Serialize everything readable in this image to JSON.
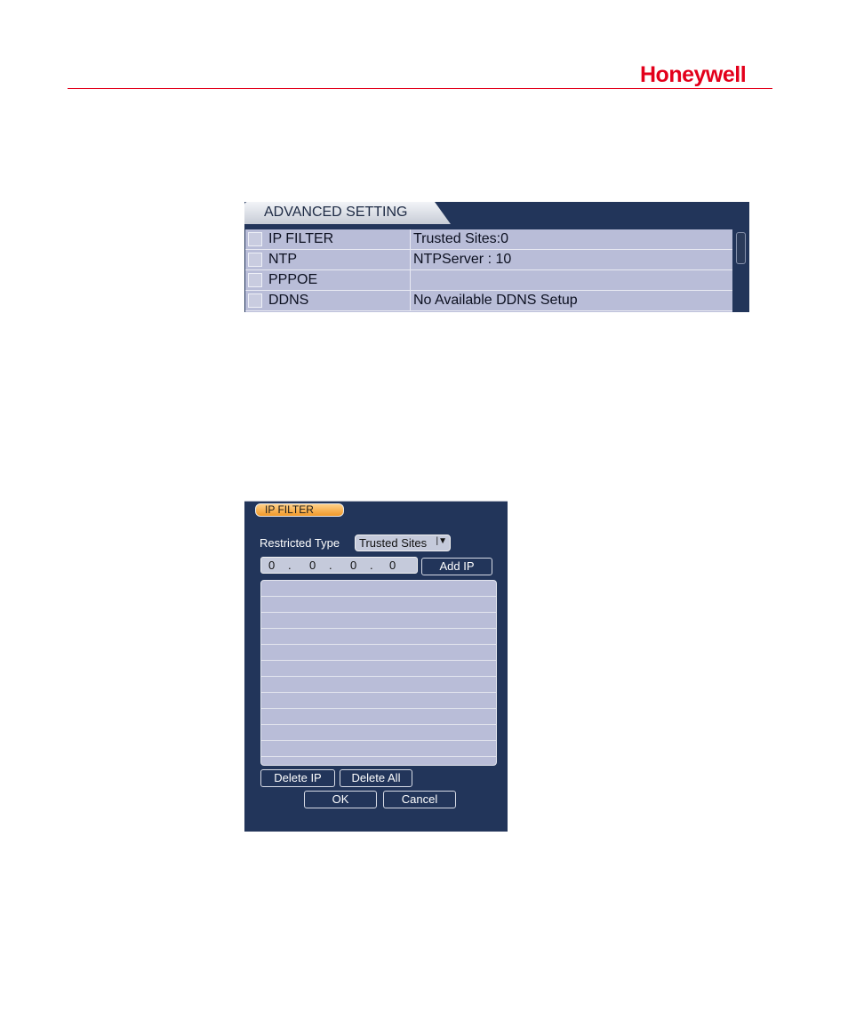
{
  "header": {
    "brand": "Honeywell"
  },
  "advanced_setting": {
    "title": "ADVANCED SETTING",
    "rows": [
      {
        "name": "IP FILTER",
        "value": "Trusted Sites:0"
      },
      {
        "name": "NTP",
        "value": "NTPServer : 10"
      },
      {
        "name": "PPPOE",
        "value": ""
      },
      {
        "name": "DDNS",
        "value": "No Available DDNS Setup"
      }
    ]
  },
  "ip_filter": {
    "title": "IP FILTER",
    "restricted_type_label": "Restricted Type",
    "restricted_type_value": "Trusted Sites",
    "ip_octets": [
      "0",
      "0",
      "0",
      "0"
    ],
    "add_ip": "Add IP",
    "delete_ip": "Delete IP",
    "delete_all": "Delete All",
    "ok": "OK",
    "cancel": "Cancel"
  },
  "colors": {
    "brand_red": "#e3001b",
    "panel_navy": "#22355a",
    "list_lavender": "#b9bdd8",
    "tab_orange": "#f19a2a"
  }
}
